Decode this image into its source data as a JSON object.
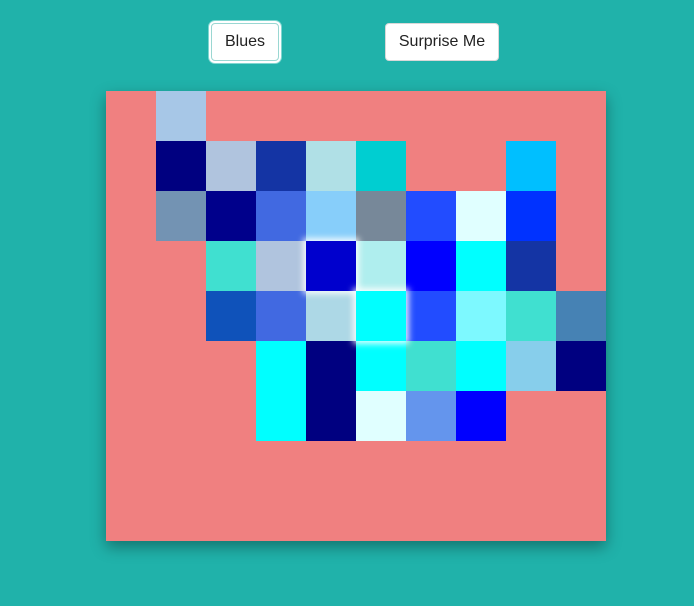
{
  "buttons": {
    "blues_label": "Blues",
    "surprise_label": "Surprise Me"
  },
  "colors": {
    "page_background": "#20b2aa",
    "canvas_background": "#f08080"
  },
  "grid": {
    "columns": 10,
    "rows": 9,
    "highlighted": [
      [
        3,
        4
      ],
      [
        4,
        5
      ]
    ],
    "cells": [
      [
        null,
        "#a7c7e7",
        null,
        null,
        null,
        null,
        null,
        null,
        null,
        null
      ],
      [
        null,
        "#000080",
        "#b0c4de",
        "#1434a4",
        "#b0e0e6",
        "#00ced1",
        null,
        null,
        "#00bfff",
        null
      ],
      [
        null,
        "#7393b3",
        "#00008b",
        "#4169e1",
        "#87cefa",
        "#778899",
        "#224cff",
        "#e0ffff",
        "#0032ff",
        null
      ],
      [
        null,
        null,
        "#40e0d0",
        "#b0c4de",
        "#0000cd",
        "#afeeee",
        "#0000ff",
        "#00ffff",
        "#1434a4",
        null
      ],
      [
        null,
        null,
        "#0f52ba",
        "#4169e1",
        "#add8e6",
        "#00ffff",
        "#224cff",
        "#7df9ff",
        "#40e0d0",
        "#4682b4"
      ],
      [
        null,
        null,
        null,
        "#00ffff",
        "#000080",
        "#00ffff",
        "#40e0d0",
        "#00ffff",
        "#87ceeb",
        "#000080"
      ],
      [
        null,
        null,
        null,
        "#00ffff",
        "#000080",
        "#e0ffff",
        "#6495ed",
        "#0000ff",
        null,
        null
      ],
      [
        null,
        null,
        null,
        null,
        null,
        null,
        null,
        null,
        null,
        null
      ],
      [
        null,
        null,
        null,
        null,
        null,
        null,
        null,
        null,
        null,
        null
      ]
    ]
  }
}
